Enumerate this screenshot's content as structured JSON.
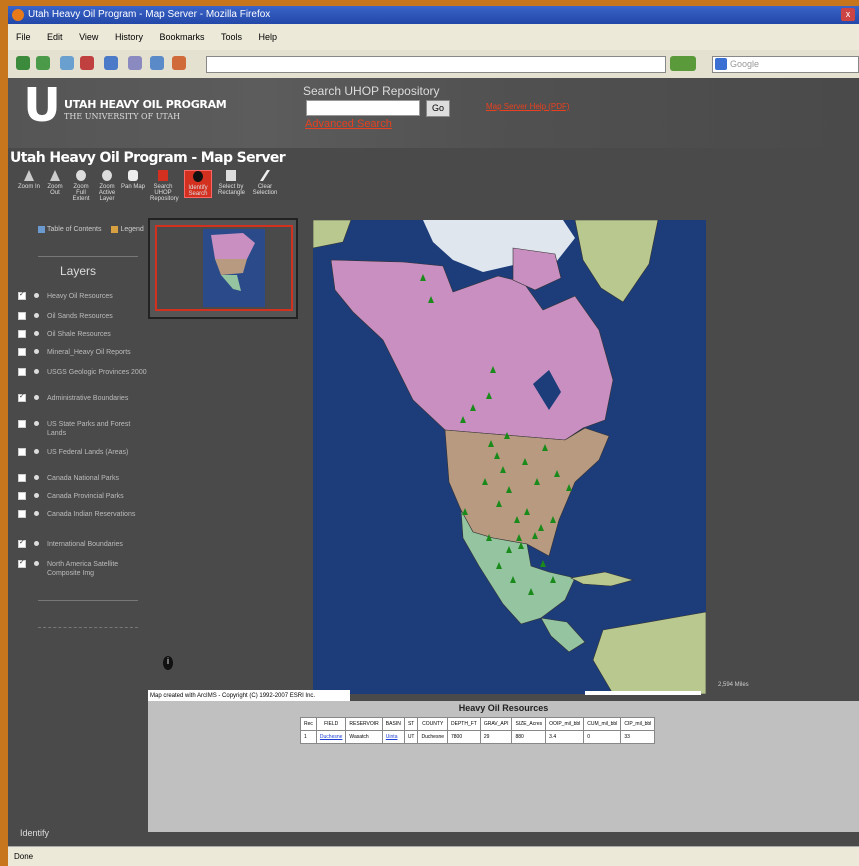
{
  "window": {
    "title": "Utah Heavy Oil Program - Map Server - Mozilla Firefox",
    "close": "x"
  },
  "menu": [
    "File",
    "Edit",
    "View",
    "History",
    "Bookmarks",
    "Tools",
    "Help"
  ],
  "browser": {
    "url": "",
    "search_placeholder": "Google"
  },
  "banner": {
    "logo_letter": "U",
    "org_name": "UTAH HEAVY OIL PROGRAM",
    "university": "THE UNIVERSITY OF UTAH",
    "search_title": "Search UHOP Repository",
    "search_button": "Go",
    "advanced_search": "Advanced Search",
    "map_help_link": "Map Server Help (PDF)"
  },
  "app_title": "Utah Heavy Oil Program - Map Server",
  "tools": [
    {
      "label": "Zoom In"
    },
    {
      "label": "Zoom Out"
    },
    {
      "label": "Zoom Full Extent"
    },
    {
      "label": "Zoom Active Layer"
    },
    {
      "label": "Pan Map"
    },
    {
      "label": "Search UHOP Repository"
    },
    {
      "label": "Identify Search"
    },
    {
      "label": "Select by Rectangle"
    },
    {
      "label": "Clear Selection"
    }
  ],
  "legend_tabs": {
    "toc": "Table of Contents",
    "legend": "Legend"
  },
  "layers_heading": "Layers",
  "layers": [
    {
      "label": "Heavy Oil Resources",
      "checked": true
    },
    {
      "label": "Oil Sands Resources",
      "checked": false
    },
    {
      "label": "Oil Shale Resources",
      "checked": false
    },
    {
      "label": "Mineral_Heavy Oil Reports",
      "checked": false
    },
    {
      "label": "USGS Geologic Provinces 2000",
      "checked": false
    },
    {
      "label": "Administrative Boundaries",
      "checked": true
    },
    {
      "label": "US State Parks and Forest Lands",
      "checked": false
    },
    {
      "label": "US Federal Lands (Areas)",
      "checked": false
    },
    {
      "label": "Canada National Parks",
      "checked": false
    },
    {
      "label": "Canada Provincial Parks",
      "checked": false
    },
    {
      "label": "Canada Indian Reservations",
      "checked": false
    },
    {
      "label": "International Boundaries",
      "checked": true
    },
    {
      "label": "North America Satellite Composite Img",
      "checked": true
    }
  ],
  "map": {
    "scale_text": "2,594 Miles",
    "copyright": "Map created with ArcIMS - Copyright (C) 1992-2007 ESRI Inc.",
    "identify_glyph": "i"
  },
  "results": {
    "title": "Heavy Oil Resources",
    "columns": [
      "Rec",
      "FIELD",
      "RESERVOIR",
      "BASIN",
      "ST",
      "COUNTY",
      "DEPTH_FT",
      "GRAV_API",
      "SIZE_Acres",
      "OOIP_mil_bbl",
      "CUM_mil_bbl",
      "CIP_mil_bbl"
    ],
    "rows": [
      [
        "1",
        "Duchesne",
        "Wasatch",
        "Uinta",
        "UT",
        "Duchesne",
        "7800",
        "29",
        "880",
        "3.4",
        "0",
        "33"
      ]
    ]
  },
  "identify_label": "Identify",
  "status": "Done",
  "colors": {
    "canada": "#c88fc0",
    "usa": "#b89a80",
    "mexico": "#94c4a0",
    "ocean": "#1d3c7a",
    "oil_sites": "#1a8a1a"
  }
}
